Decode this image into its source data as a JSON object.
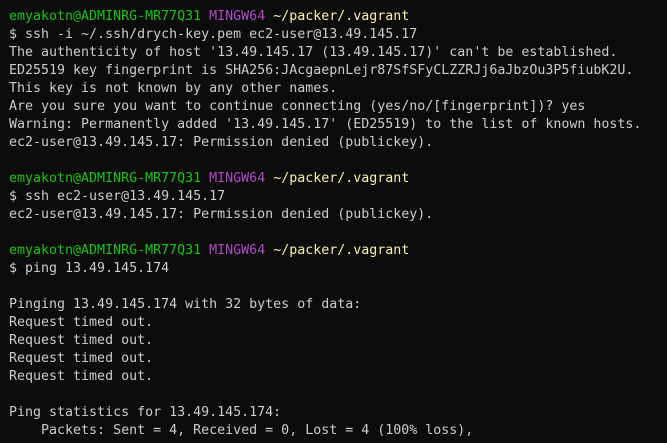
{
  "terminal": {
    "lines": [
      {
        "type": "prompt",
        "user": "emyakotn@ADMINRG-MR77Q31",
        "env": "MINGW64",
        "path": "~/packer/.vagrant"
      },
      {
        "type": "text",
        "text": "$ ssh -i ~/.ssh/drych-key.pem ec2-user@13.49.145.17"
      },
      {
        "type": "text",
        "text": "The authenticity of host '13.49.145.17 (13.49.145.17)' can't be established."
      },
      {
        "type": "text",
        "text": "ED25519 key fingerprint is SHA256:JAcgaepnLejr87SfSFyCLZZRJj6aJbzOu3P5fiubK2U."
      },
      {
        "type": "text",
        "text": "This key is not known by any other names."
      },
      {
        "type": "text",
        "text": "Are you sure you want to continue connecting (yes/no/[fingerprint])? yes"
      },
      {
        "type": "text",
        "text": "Warning: Permanently added '13.49.145.17' (ED25519) to the list of known hosts."
      },
      {
        "type": "text",
        "text": "ec2-user@13.49.145.17: Permission denied (publickey)."
      },
      {
        "type": "text",
        "text": ""
      },
      {
        "type": "prompt",
        "user": "emyakotn@ADMINRG-MR77Q31",
        "env": "MINGW64",
        "path": "~/packer/.vagrant"
      },
      {
        "type": "text",
        "text": "$ ssh ec2-user@13.49.145.17"
      },
      {
        "type": "text",
        "text": "ec2-user@13.49.145.17: Permission denied (publickey)."
      },
      {
        "type": "text",
        "text": ""
      },
      {
        "type": "prompt",
        "user": "emyakotn@ADMINRG-MR77Q31",
        "env": "MINGW64",
        "path": "~/packer/.vagrant"
      },
      {
        "type": "text",
        "text": "$ ping 13.49.145.174"
      },
      {
        "type": "text",
        "text": ""
      },
      {
        "type": "text",
        "text": "Pinging 13.49.145.174 with 32 bytes of data:"
      },
      {
        "type": "text",
        "text": "Request timed out."
      },
      {
        "type": "text",
        "text": "Request timed out."
      },
      {
        "type": "text",
        "text": "Request timed out."
      },
      {
        "type": "text",
        "text": "Request timed out."
      },
      {
        "type": "text",
        "text": ""
      },
      {
        "type": "text",
        "text": "Ping statistics for 13.49.145.174:"
      },
      {
        "type": "text",
        "text": "    Packets: Sent = 4, Received = 0, Lost = 4 (100% loss),"
      }
    ]
  },
  "colors": {
    "background": "#0c0c0c",
    "text": "#cccccc",
    "user": "#16c60c",
    "env": "#b148c6",
    "path": "#f9f1a5"
  }
}
